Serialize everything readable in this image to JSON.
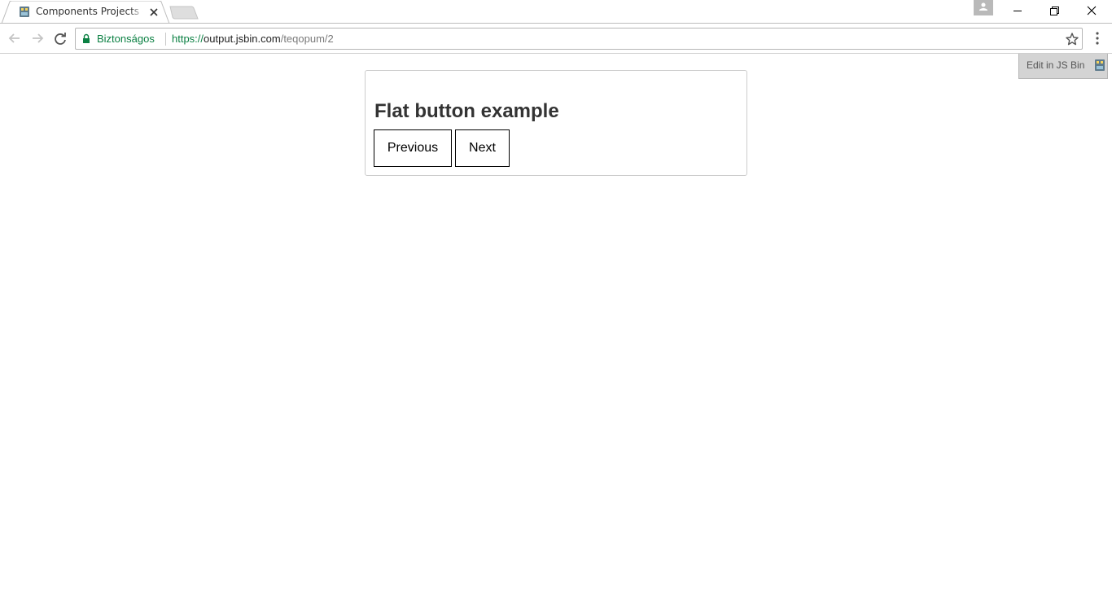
{
  "browser": {
    "tab": {
      "title": "Components Projects - Bin",
      "favicon": "jsbin-icon"
    },
    "secure_label": "Biztonságos",
    "url": {
      "scheme": "https://",
      "host": "output.jsbin.com",
      "path": "/teqopum/2"
    },
    "colors": {
      "secure": "#0b8043"
    }
  },
  "page": {
    "card": {
      "title": "Flat button example",
      "buttons": {
        "previous": "Previous",
        "next": "Next"
      }
    },
    "jsbin_edit_label": "Edit in JS Bin"
  }
}
